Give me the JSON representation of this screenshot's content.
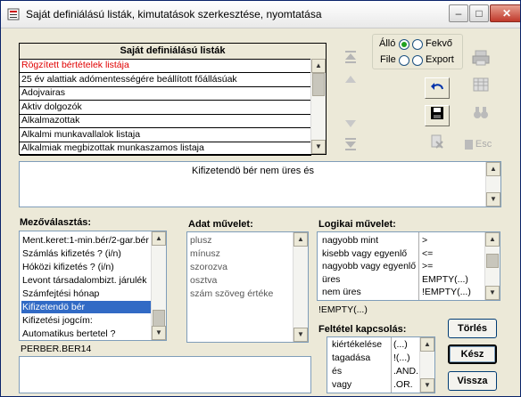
{
  "window": {
    "title": "Saját definiálású listák, kimutatások szerkesztése, nyomtatása"
  },
  "title_buttons": {
    "minimize": "–",
    "maximize": "□",
    "close": "✕"
  },
  "list": {
    "header": "Saját definiálású listák",
    "items": [
      {
        "label": "Rögzített bértételek listája",
        "highlight": true
      },
      {
        "label": "25 év alattiak adómentességére beállított főállásúak"
      },
      {
        "label": "Adojvairas"
      },
      {
        "label": "Aktiv dolgozók"
      },
      {
        "label": "Alkalmazottak"
      },
      {
        "label": "Alkalmi munkavallalok listaja"
      },
      {
        "label": "Alkalmiak megbizottak munkaszamos listaja"
      }
    ]
  },
  "orientation": {
    "allo": "Álló",
    "fekvo": "Fekvő",
    "file": "File",
    "export": "Export",
    "selected_orientation": "allo"
  },
  "condition_text": "Kifizetendö bér nem üres és",
  "mezovalasztas": {
    "label": "Mezőválasztás:",
    "items": [
      "Ment.keret:1-min.bér/2-gar.bér",
      "Számlás kifizetés ? (i/n)",
      "Hóközi kifizetés ? (i/n)",
      "Levont társadalombizt. járulék",
      "Számfejtési hónap",
      "Kifizetendö bér",
      "Kifizetési jogcím:",
      "Automatikus bertetel ?"
    ],
    "selected_index": 5,
    "field_code": "PERBER.BER14"
  },
  "adat_muvelet": {
    "label": "Adat művelet:",
    "items": [
      "plusz",
      "mínusz",
      "szorozva",
      "osztva",
      "szám szöveg értéke"
    ]
  },
  "logikai_muvelet": {
    "label": "Logikai művelet:",
    "rows": [
      {
        "name": "nagyobb mint",
        "op": ">"
      },
      {
        "name": "kisebb vagy egyenlő",
        "op": "<="
      },
      {
        "name": "nagyobb vagy egyenlő",
        "op": ">="
      },
      {
        "name": "üres",
        "op": "EMPTY(...)"
      },
      {
        "name": "nem üres",
        "op": "!EMPTY(...)"
      }
    ],
    "selected_op": "!EMPTY(...)"
  },
  "feltetel_kapcsolas": {
    "label": "Feltétel kapcsolás:",
    "rows": [
      {
        "name": "kiértékelése",
        "op": "(...)"
      },
      {
        "name": "tagadása",
        "op": "!(...)"
      },
      {
        "name": "és",
        "op": ".AND."
      },
      {
        "name": "vagy",
        "op": ".OR."
      }
    ]
  },
  "buttons": {
    "torles": "Törlés",
    "kesz": "Kész",
    "vissza": "Vissza",
    "esc": "Esc"
  },
  "colors": {
    "highlight_text": "#e00000",
    "selection": "#316ac5",
    "window_bg": "#ece9d8"
  }
}
